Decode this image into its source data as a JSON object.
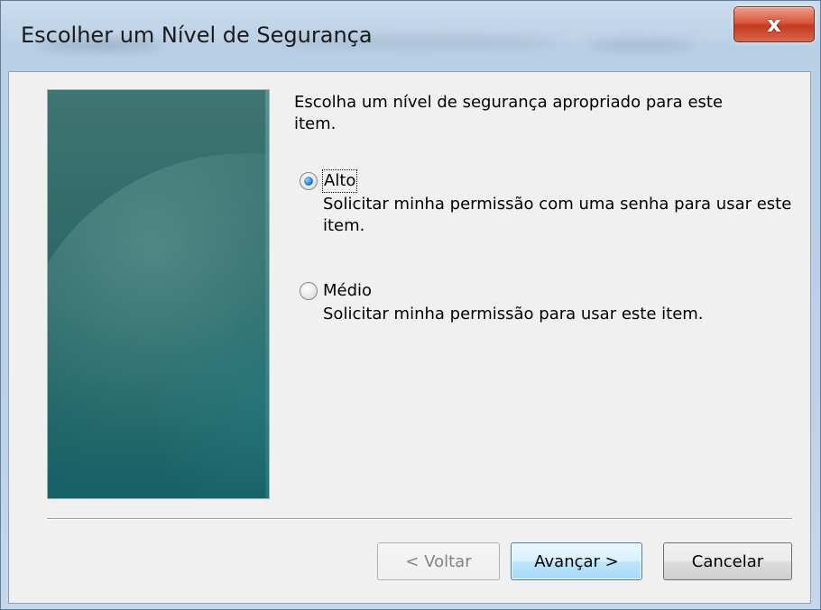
{
  "window": {
    "title": "Escolher um Nível de Segurança",
    "close_glyph": "x"
  },
  "content": {
    "prompt": "Escolha um nível de segurança apropriado para este item."
  },
  "options": [
    {
      "label": "Alto",
      "description": "Solicitar minha permissão com uma senha para usar este item.",
      "selected": true
    },
    {
      "label": "Médio",
      "description": "Solicitar minha permissão para usar este item.",
      "selected": false
    }
  ],
  "buttons": {
    "back_label": "< Voltar",
    "next_label": "Avançar >",
    "cancel_label": "Cancelar"
  },
  "colors": {
    "accent": "#2f7fd6",
    "close_button": "#c43a1f",
    "side_panel": "#1f6466"
  }
}
